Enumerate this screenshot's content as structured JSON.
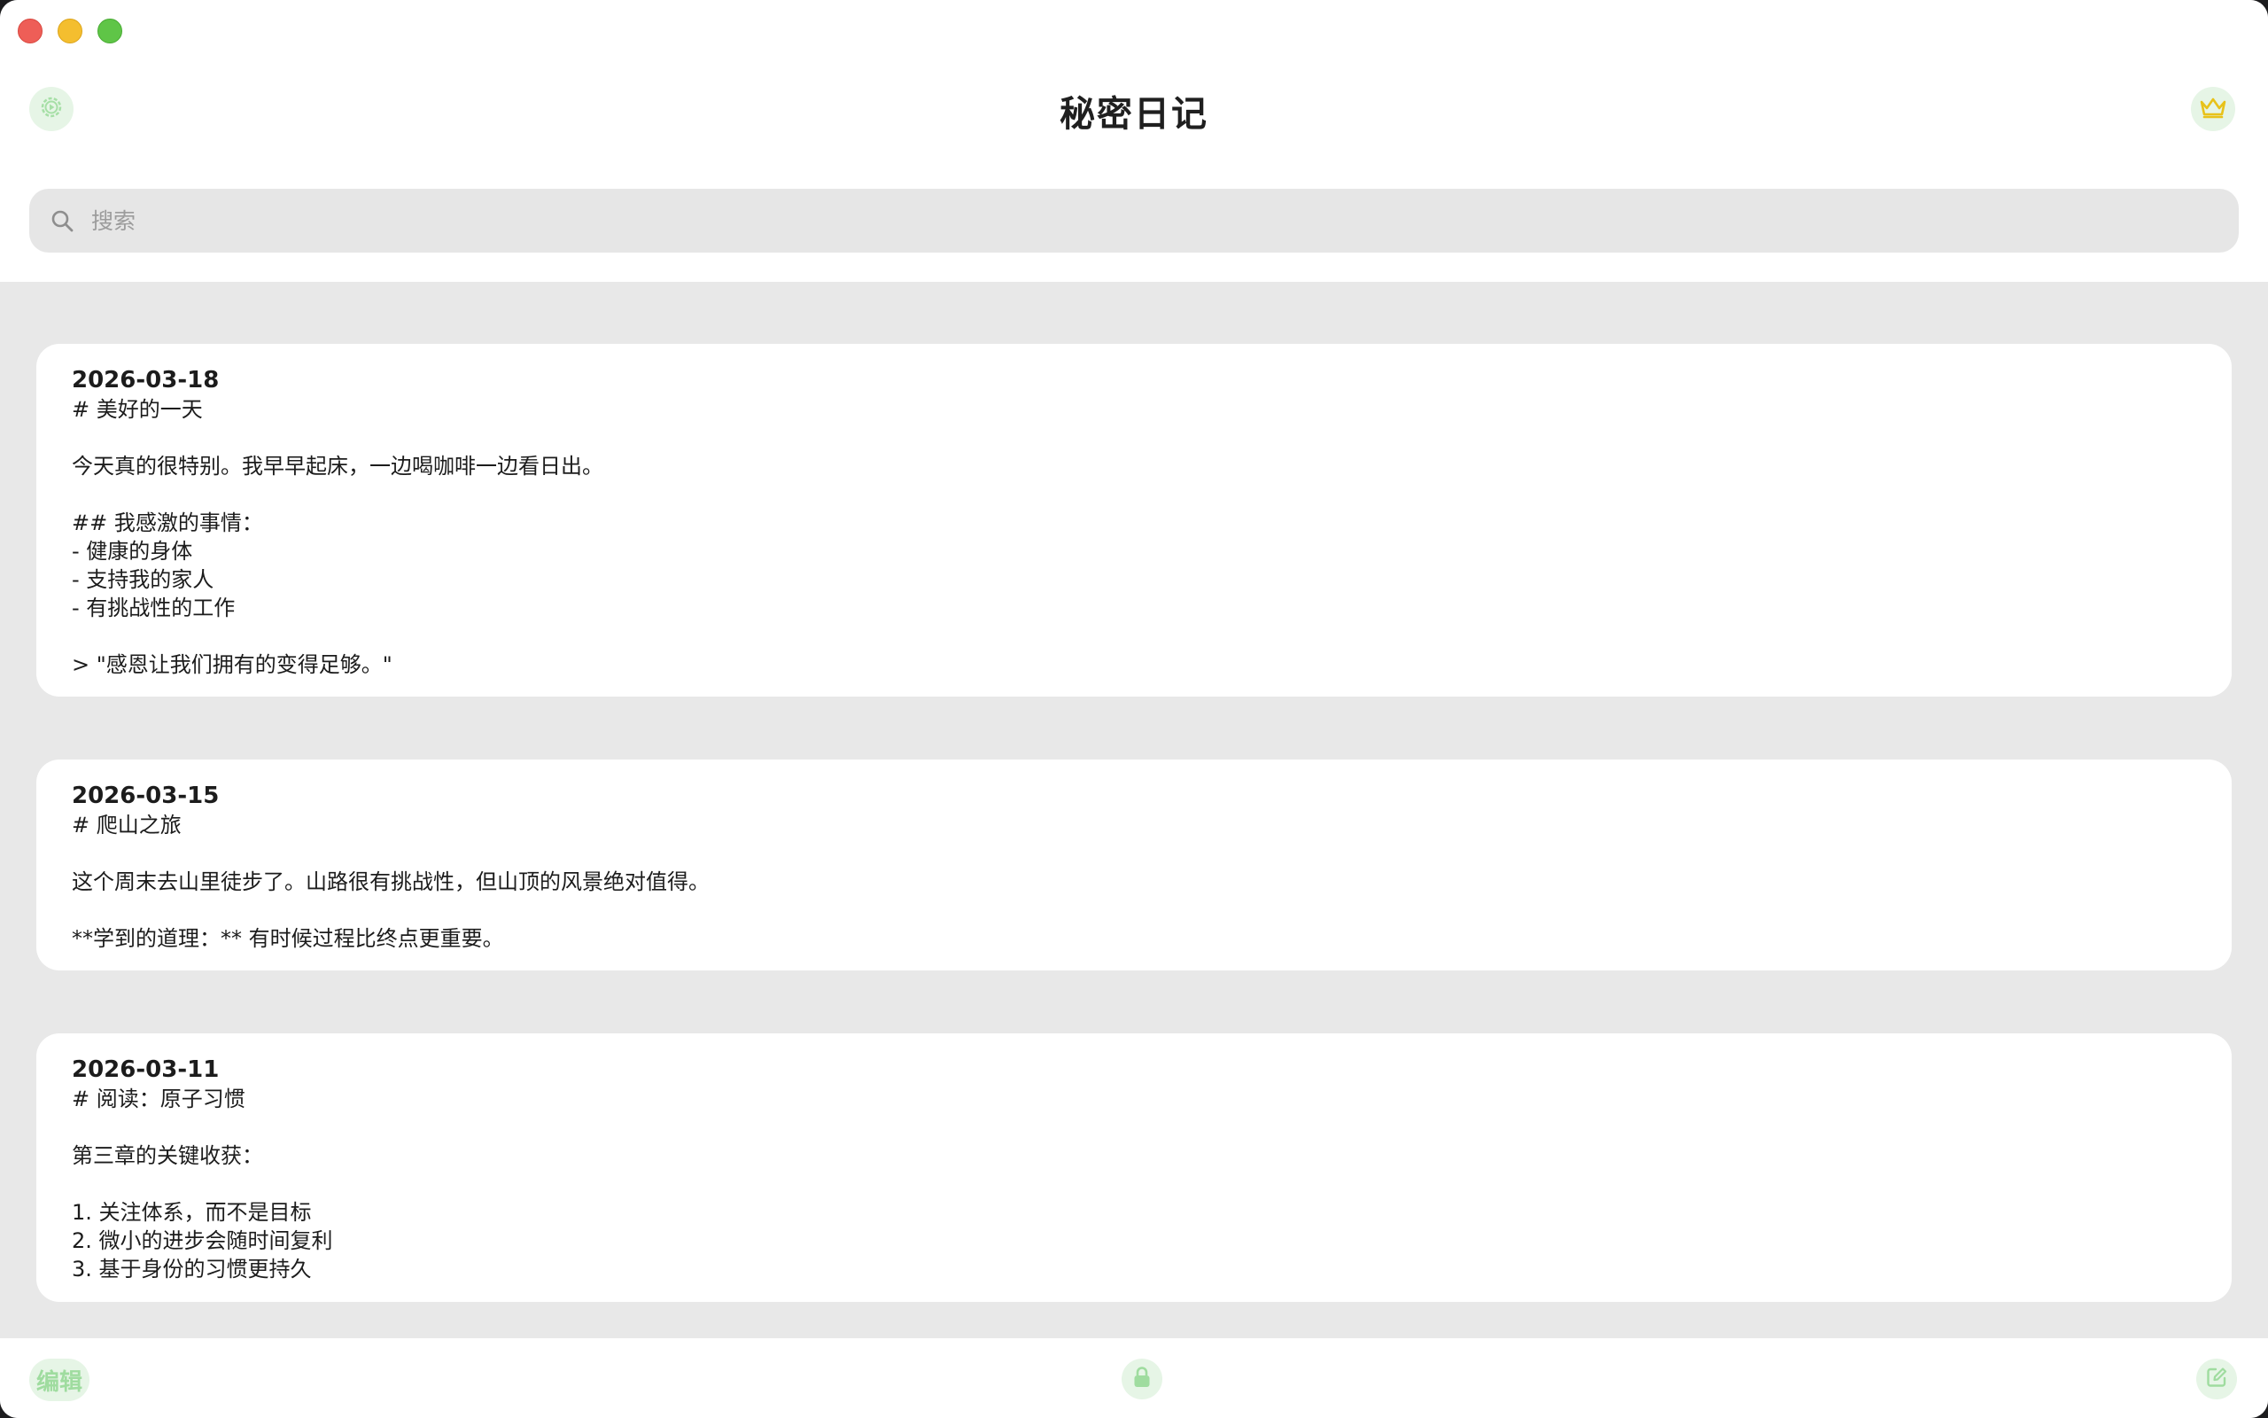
{
  "app": {
    "title": "秘密日记"
  },
  "search": {
    "placeholder": "搜索"
  },
  "entries": [
    {
      "date": "2026-03-18",
      "lines": [
        "# 美好的一天",
        "",
        "今天真的很特别。我早早起床，一边喝咖啡一边看日出。",
        "",
        "## 我感激的事情：",
        "- 健康的身体",
        "- 支持我的家人",
        "- 有挑战性的工作",
        "",
        "> \"感恩让我们拥有的变得足够。\""
      ]
    },
    {
      "date": "2026-03-15",
      "lines": [
        "# 爬山之旅",
        "",
        "这个周末去山里徒步了。山路很有挑战性，但山顶的风景绝对值得。",
        "",
        "**学到的道理：** 有时候过程比终点更重要。"
      ]
    },
    {
      "date": "2026-03-11",
      "lines": [
        "# 阅读：原子习惯",
        "",
        "第三章的关键收获：",
        "",
        "1. 关注体系，而不是目标",
        "2. 微小的进步会随时间复利",
        "3. 基于身份的习惯更持久"
      ]
    }
  ],
  "bottom": {
    "edit_label": "编辑"
  },
  "colors": {
    "accent": "#9fdc9f",
    "accent_bg": "#e6f5e6",
    "crown": "#e8c21a"
  },
  "icons": {
    "settings": "settings-icon",
    "premium": "crown-icon",
    "search": "search-icon",
    "lock": "lock-icon",
    "compose": "compose-icon"
  }
}
